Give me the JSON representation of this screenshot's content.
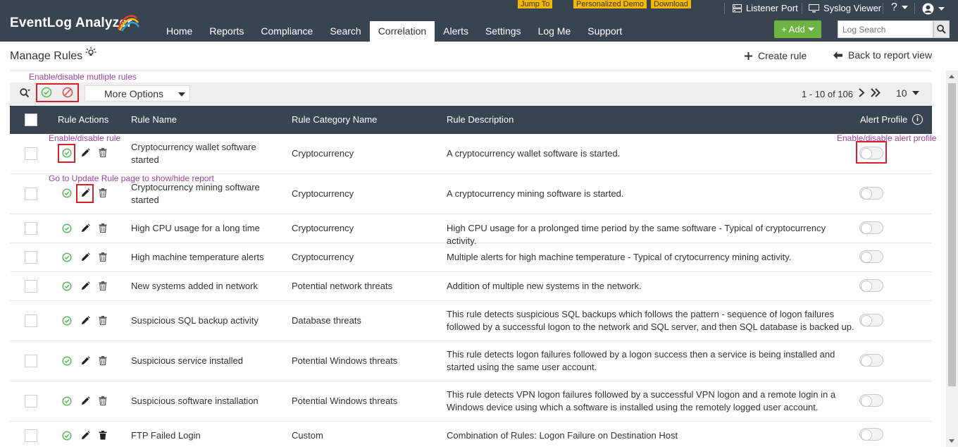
{
  "app": {
    "name": "EventLog Analyzer"
  },
  "promos": {
    "jump_to": "Jump To",
    "personalized_demo": "Personalized Demo",
    "download": "Download"
  },
  "utility": {
    "listener_port": "Listener Port",
    "syslog_viewer": "Syslog Viewer",
    "help": "?"
  },
  "nav": {
    "home": "Home",
    "reports": "Reports",
    "compliance": "Compliance",
    "search": "Search",
    "correlation": "Correlation",
    "alerts": "Alerts",
    "settings": "Settings",
    "logme": "Log Me",
    "support": "Support"
  },
  "add_button": "+ Add",
  "log_search": {
    "placeholder": "Log Search"
  },
  "page": {
    "title": "Manage Rules",
    "create_rule": "Create rule",
    "back": "Back to report view"
  },
  "annotations": {
    "multi": "Enable/disable mutliple rules",
    "single": "Enable/disable rule",
    "edit": "Go to Update Rule page to show/hide report",
    "alert_profile": "Enable/disable alert profile"
  },
  "toolbar": {
    "more_options": "More Options",
    "range": "1 - 10 of 106",
    "per_page": "10"
  },
  "columns": {
    "actions": "Rule Actions",
    "name": "Rule Name",
    "category": "Rule Category Name",
    "description": "Rule Description",
    "alert_profile": "Alert Profile"
  },
  "rows": [
    {
      "name": "Cryptocurrency wallet software started",
      "category": "Cryptocurrency",
      "description": "A cryptocurrency wallet software is started."
    },
    {
      "name": "Cryptocurrency mining software started",
      "category": "Cryptocurrency",
      "description": "A cryptocurrency mining software is started."
    },
    {
      "name": "High CPU usage for a long time",
      "category": "Cryptocurrency",
      "description": "High CPU usage for a prolonged time period by the same software - Typical of cryptocurrency activity."
    },
    {
      "name": "High machine temperature alerts",
      "category": "Cryptocurrency",
      "description": "Multiple alerts for high machine temperature - Typical of crytocurrency mining activity."
    },
    {
      "name": "New systems added in network",
      "category": "Potential network threats",
      "description": "Addition of multiple new systems in the network."
    },
    {
      "name": "Suspicious SQL backup activity",
      "category": "Database threats",
      "description": "This rule detects suspicious SQL backups which follows the pattern - sequence of logon failures followed by a successful logon to the network and SQL server, and then SQL database is backed up."
    },
    {
      "name": "Suspicious service installed",
      "category": "Potential Windows threats",
      "description": "This rule detects logon failures followed by a logon success then a service is being installed and started using the same user account."
    },
    {
      "name": "Suspicious software installation",
      "category": "Potential Windows threats",
      "description": "This rule detects VPN logon failures followed by a successful VPN logon and a remote login in a Windows device using which a software is installed using the remotely logged user account."
    },
    {
      "name": "FTP Failed Login",
      "category": "Custom",
      "description": "Combination of Rules: Logon Failure on Destination Host"
    }
  ],
  "colors": {
    "header_bg": "#3a4451",
    "enable_green": "#5cb85c",
    "disable_red": "#d9534f",
    "annotation": "#a0419e",
    "highlight_red": "#d9202a",
    "add_green": "#6cb33f",
    "promo_yellow": "#f5b800"
  }
}
